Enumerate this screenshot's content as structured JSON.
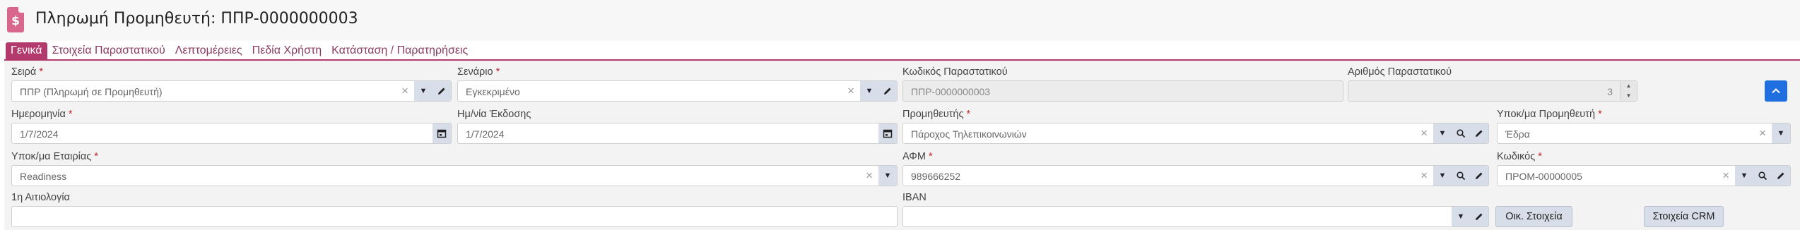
{
  "header": {
    "title": "Πληρωμή Προμηθευτή: ΠΠΡ-0000000003",
    "icon": "dollar-document-icon"
  },
  "tabs": [
    {
      "label": "Γενικά",
      "active": true
    },
    {
      "label": "Στοιχεία Παραστατικού",
      "active": false
    },
    {
      "label": "Λεπτομέρειες",
      "active": false
    },
    {
      "label": "Πεδία Χρήστη",
      "active": false
    },
    {
      "label": "Κατάσταση / Παρατηρήσεις",
      "active": false
    }
  ],
  "form": {
    "series": {
      "label": "Σειρά",
      "value": "ΠΠΡ (Πληρωμή σε Προμηθευτή)"
    },
    "scenario": {
      "label": "Σενάριο",
      "value": "Εγκεκριμένο"
    },
    "doc_code": {
      "label": "Κωδικός Παραστατικού",
      "value": "ΠΠΡ-0000000003"
    },
    "doc_number": {
      "label": "Αριθμός Παραστατικού",
      "value": "3"
    },
    "date": {
      "label": "Ημερομηνία",
      "value": "1/7/2024"
    },
    "issue_date": {
      "label": "Ημ/νία Έκδοσης",
      "value": "1/7/2024"
    },
    "supplier": {
      "label": "Προμηθευτής",
      "value": "Πάροχος Τηλεπικοινωνιών"
    },
    "supplier_branch": {
      "label": "Υποκ/μα Προμηθευτή",
      "value": "Έδρα"
    },
    "company_branch": {
      "label": "Υποκ/μα Εταιρίας",
      "value": "Readiness"
    },
    "vat": {
      "label": "ΑΦΜ",
      "value": "989666252"
    },
    "code": {
      "label": "Κωδικός",
      "value": "ΠΡΟΜ-00000005"
    },
    "reason": {
      "label": "1η Αιτιολογία",
      "value": ""
    },
    "iban": {
      "label": "IBAN",
      "value": ""
    }
  },
  "buttons": {
    "financial": "Οικ. Στοιχεία",
    "crm": "Στοιχεία CRM"
  },
  "colors": {
    "accent": "#b33a6d",
    "primary": "#1f6fe0",
    "required": "#c0262d"
  }
}
